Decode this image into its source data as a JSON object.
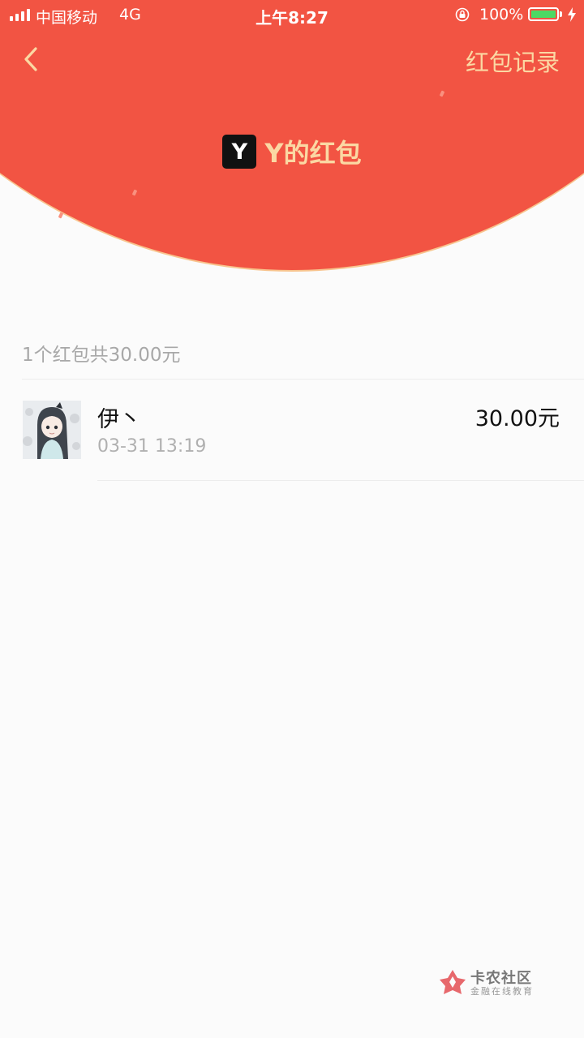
{
  "status_bar": {
    "carrier": "中国移动",
    "network": "4G",
    "time": "上午8:27",
    "battery": "100%"
  },
  "nav": {
    "back_icon": "chevron-left-icon",
    "records_label": "红包记录"
  },
  "header": {
    "avatar_letter": "Y",
    "title": "Y的红包"
  },
  "summary": "1个红包共30.00元",
  "items": [
    {
      "name": "伊丶",
      "time": "03-31 13:19",
      "amount": "30.00元"
    }
  ],
  "watermark": {
    "title": "卡农社区",
    "subtitle": "金融在线教育"
  },
  "colors": {
    "header_red": "#f25443",
    "header_gold": "#fbd8a3",
    "background": "#fbfbfb"
  }
}
